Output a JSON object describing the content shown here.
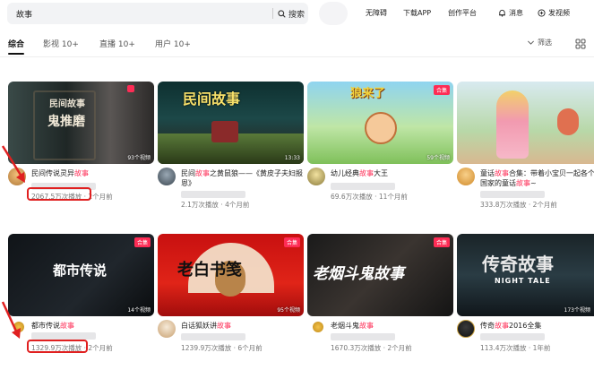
{
  "search": {
    "value": "故事",
    "button_label": "搜索"
  },
  "nav": {
    "accessibility": "无障碍",
    "download": "下载APP",
    "creator": "创作平台",
    "messages": "消息",
    "publish": "发视频"
  },
  "tabs": [
    {
      "label": "综合"
    },
    {
      "label": "影视 10+"
    },
    {
      "label": "直播 10+"
    },
    {
      "label": "用户 10+"
    }
  ],
  "filter_label": "筛选",
  "colors": {
    "accent": "#fe2c55",
    "highlight_box": "#e02020"
  },
  "cards": [
    {
      "thumb_title": "民间故事",
      "thumb_subtitle": "鬼推磨",
      "count": "93个视频",
      "title_prefix": "民间传说灵异",
      "title_highlight": "故事",
      "title_suffix": "",
      "plays": "2067.5万次播放",
      "time": "2个月前"
    },
    {
      "thumb_title": "民间故事",
      "thumb_subtitle": "",
      "count": "13:33",
      "title_prefix": "民间",
      "title_highlight": "故事",
      "title_suffix": "之黄鼠狼——《黄皮子夫妇报恩》",
      "plays": "2.1万次播放",
      "time": "4个月前"
    },
    {
      "thumb_title": "狼来了",
      "thumb_subtitle": "",
      "badge": "合集",
      "count": "59个视频",
      "title_prefix": "幼儿经典",
      "title_highlight": "故事",
      "title_suffix": "大王",
      "plays": "69.6万次播放",
      "time": "11个月前"
    },
    {
      "thumb_title": "",
      "thumb_subtitle": "",
      "count": "",
      "title_prefix": "童话",
      "title_highlight": "故事",
      "title_suffix": "合集：带着小宝贝一起各个国家的童话",
      "title_highlight2": "故事",
      "title_end": "~",
      "plays": "333.8万次播放",
      "time": "2个月前"
    },
    {
      "thumb_title": "都市传说",
      "thumb_subtitle": "",
      "badge": "合集",
      "count": "14个视频",
      "title_prefix": "都市传说",
      "title_highlight": "故事",
      "title_suffix": "",
      "plays": "1329.9万次播放",
      "time": "2个月前"
    },
    {
      "thumb_title": "老白书笺",
      "thumb_subtitle": "",
      "badge": "合集",
      "count": "95个视频",
      "title_prefix": "白话狐妖讲",
      "title_highlight": "故事",
      "title_suffix": "",
      "plays": "1239.9万次播放",
      "time": "6个月前"
    },
    {
      "thumb_title": "老烟斗鬼故事",
      "thumb_subtitle": "",
      "badge": "合集",
      "count": "",
      "title_prefix": "老烟斗鬼",
      "title_highlight": "故事",
      "title_suffix": "",
      "plays": "1670.3万次播放",
      "time": "2个月前"
    },
    {
      "thumb_title": "传奇故事",
      "thumb_subtitle": "NIGHT TALE",
      "count": "173个视频",
      "title_prefix": "传奇",
      "title_highlight": "故事",
      "title_suffix": "2016全集",
      "plays": "113.4万次播放",
      "time": "1年前"
    }
  ]
}
